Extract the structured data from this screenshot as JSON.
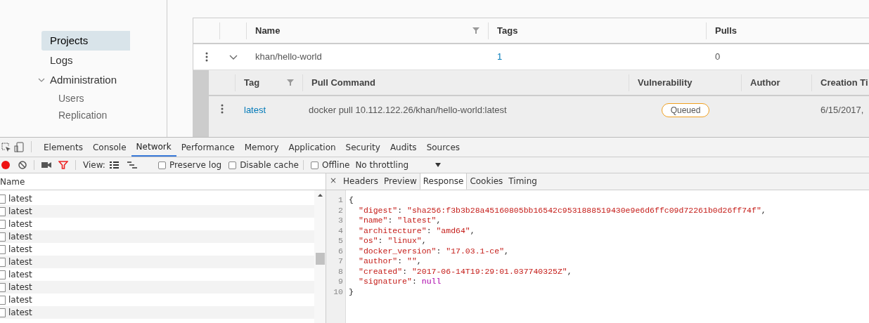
{
  "sidebar": {
    "items": [
      {
        "label": "Projects",
        "selected": true
      },
      {
        "label": "Logs",
        "selected": false
      },
      {
        "label": "Administration",
        "selected": false,
        "expanded": true,
        "children": [
          {
            "label": "Users",
            "selected": false
          },
          {
            "label": "Replication",
            "selected": false
          }
        ]
      }
    ]
  },
  "repo_table": {
    "columns": [
      "Name",
      "Tags",
      "Pulls"
    ],
    "rows": [
      {
        "name": "khan/hello-world",
        "tags": "1",
        "pulls": "0",
        "expanded": true,
        "tag_table": {
          "columns": [
            "Tag",
            "Pull Command",
            "Vulnerability",
            "Author",
            "Creation Ti"
          ],
          "rows": [
            {
              "tag": "latest",
              "pull_command": "docker pull 10.112.122.26/khan/hello-world:latest",
              "vulnerability": "Queued",
              "author": "",
              "created": "6/15/2017,"
            }
          ]
        }
      }
    ]
  },
  "devtools": {
    "tabs": [
      {
        "label": "Elements",
        "selected": false
      },
      {
        "label": "Console",
        "selected": false
      },
      {
        "label": "Network",
        "selected": true
      },
      {
        "label": "Performance",
        "selected": false
      },
      {
        "label": "Memory",
        "selected": false
      },
      {
        "label": "Application",
        "selected": false
      },
      {
        "label": "Security",
        "selected": false
      },
      {
        "label": "Audits",
        "selected": false
      },
      {
        "label": "Sources",
        "selected": false
      }
    ],
    "toolbar": {
      "recording": true,
      "view_label": "View:",
      "options": [
        {
          "label": "Preserve log",
          "checked": false
        },
        {
          "label": "Disable cache",
          "checked": false
        },
        {
          "label": "Offline",
          "checked": false
        }
      ],
      "throttling": "No throttling"
    },
    "requests": {
      "column": "Name",
      "rows": [
        "latest",
        "latest",
        "latest",
        "latest",
        "latest",
        "latest",
        "latest",
        "latest",
        "latest",
        "latest"
      ]
    },
    "detail_close": "×",
    "detail_tabs": [
      {
        "label": "Headers",
        "selected": false
      },
      {
        "label": "Preview",
        "selected": false
      },
      {
        "label": "Response",
        "selected": true
      },
      {
        "label": "Cookies",
        "selected": false
      },
      {
        "label": "Timing",
        "selected": false
      }
    ],
    "response": [
      {
        "number": "1",
        "parts": [
          {
            "kind": "punct",
            "text": "{"
          }
        ]
      },
      {
        "number": "2",
        "parts": [
          {
            "kind": "key",
            "text": "\"digest\""
          },
          {
            "kind": "punct",
            "text": ": "
          },
          {
            "kind": "string",
            "text": "\"sha256:f3b3b28a45160805bb16542c9531888519430e9e6d6ffc09d72261b0d26ff74f\""
          },
          {
            "kind": "punct",
            "text": ","
          }
        ]
      },
      {
        "number": "3",
        "parts": [
          {
            "kind": "key",
            "text": "\"name\""
          },
          {
            "kind": "punct",
            "text": ": "
          },
          {
            "kind": "string",
            "text": "\"latest\""
          },
          {
            "kind": "punct",
            "text": ","
          }
        ]
      },
      {
        "number": "4",
        "parts": [
          {
            "kind": "key",
            "text": "\"architecture\""
          },
          {
            "kind": "punct",
            "text": ": "
          },
          {
            "kind": "string",
            "text": "\"amd64\""
          },
          {
            "kind": "punct",
            "text": ","
          }
        ]
      },
      {
        "number": "5",
        "parts": [
          {
            "kind": "key",
            "text": "\"os\""
          },
          {
            "kind": "punct",
            "text": ": "
          },
          {
            "kind": "string",
            "text": "\"linux\""
          },
          {
            "kind": "punct",
            "text": ","
          }
        ]
      },
      {
        "number": "6",
        "parts": [
          {
            "kind": "key",
            "text": "\"docker_version\""
          },
          {
            "kind": "punct",
            "text": ": "
          },
          {
            "kind": "string",
            "text": "\"17.03.1-ce\""
          },
          {
            "kind": "punct",
            "text": ","
          }
        ]
      },
      {
        "number": "7",
        "parts": [
          {
            "kind": "key",
            "text": "\"author\""
          },
          {
            "kind": "punct",
            "text": ": "
          },
          {
            "kind": "string",
            "text": "\"\""
          },
          {
            "kind": "punct",
            "text": ","
          }
        ]
      },
      {
        "number": "8",
        "parts": [
          {
            "kind": "key",
            "text": "\"created\""
          },
          {
            "kind": "punct",
            "text": ": "
          },
          {
            "kind": "string",
            "text": "\"2017-06-14T19:29:01.037740325Z\""
          },
          {
            "kind": "punct",
            "text": ","
          }
        ]
      },
      {
        "number": "9",
        "parts": [
          {
            "kind": "key",
            "text": "\"signature\""
          },
          {
            "kind": "punct",
            "text": ": "
          },
          {
            "kind": "null",
            "text": "null"
          }
        ]
      },
      {
        "number": "10",
        "parts": [
          {
            "kind": "punct",
            "text": "}"
          }
        ]
      }
    ]
  }
}
